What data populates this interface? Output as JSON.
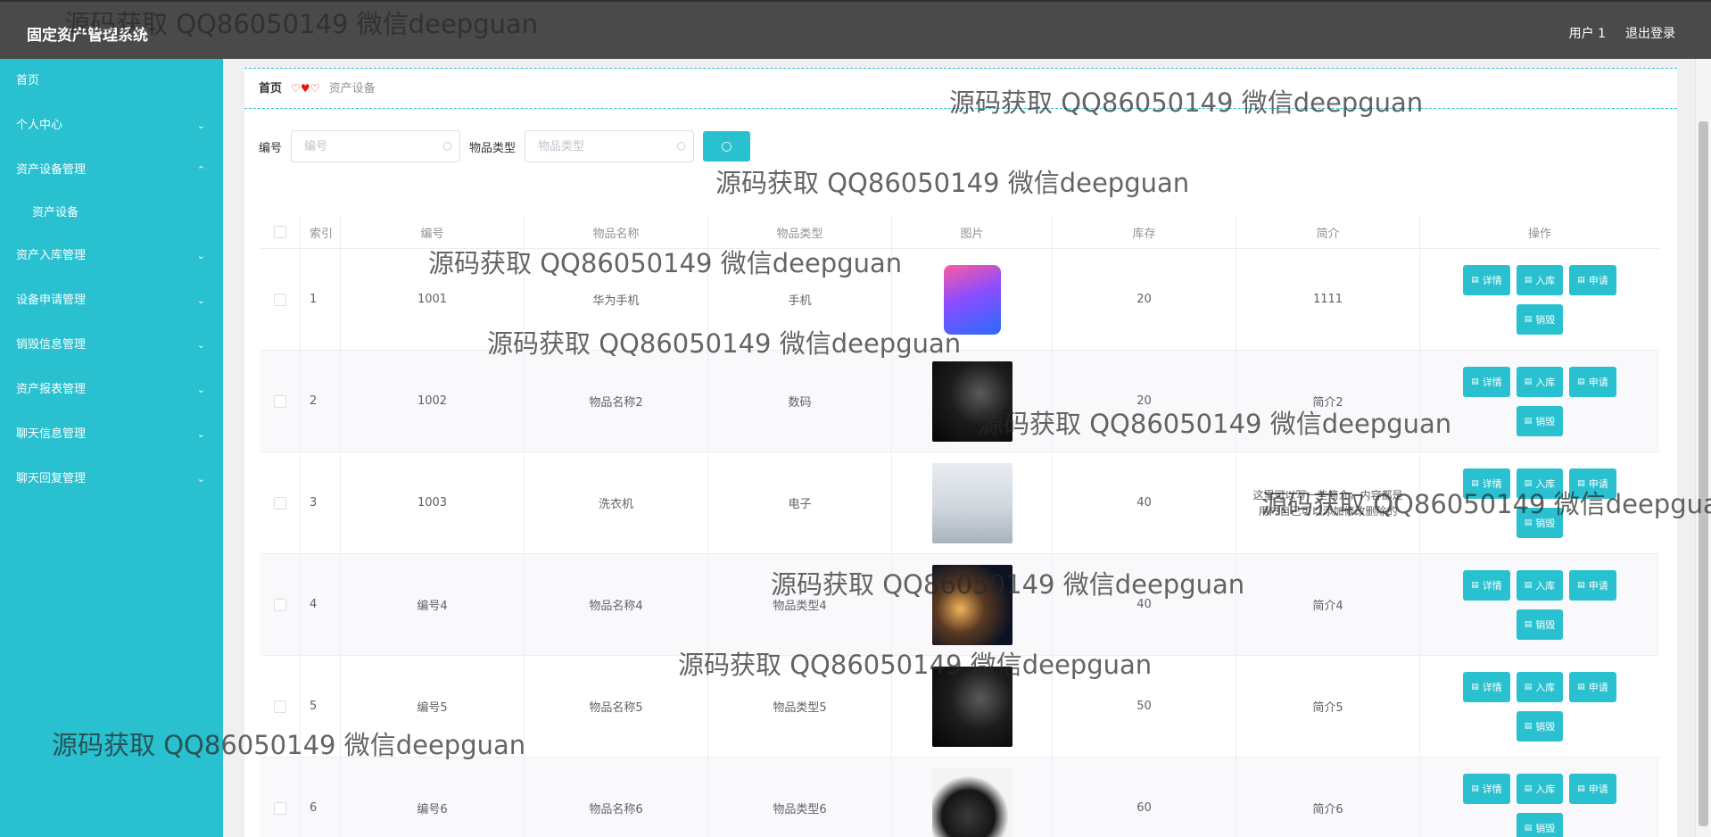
{
  "app": {
    "title": "固定资产管理系统"
  },
  "header": {
    "user": "用户 1",
    "logout": "退出登录"
  },
  "sidebar": {
    "items": [
      {
        "label": "首页",
        "chevron": ""
      },
      {
        "label": "个人中心",
        "chevron": "⌄"
      },
      {
        "label": "资产设备管理",
        "chevron": "⌃"
      },
      {
        "label": "资产设备",
        "chevron": ""
      },
      {
        "label": "资产入库管理",
        "chevron": "⌄"
      },
      {
        "label": "设备申请管理",
        "chevron": "⌄"
      },
      {
        "label": "销毁信息管理",
        "chevron": "⌄"
      },
      {
        "label": "资产报表管理",
        "chevron": "⌄"
      },
      {
        "label": "聊天信息管理",
        "chevron": "⌄"
      },
      {
        "label": "聊天回复管理",
        "chevron": "⌄"
      }
    ]
  },
  "breadcrumb": {
    "home": "首页",
    "separator": "♡♥♡",
    "current": "资产设备"
  },
  "search": {
    "code_label": "编号",
    "code_placeholder": "编号",
    "type_label": "物品类型",
    "type_placeholder": "物品类型",
    "button_icon": "search-icon"
  },
  "table": {
    "headers": {
      "index": "索引",
      "code": "编号",
      "name": "物品名称",
      "type": "物品类型",
      "image": "图片",
      "stock": "库存",
      "desc": "简介",
      "ops": "操作"
    },
    "rows": [
      {
        "index": "1",
        "code": "1001",
        "name": "华为手机",
        "type": "手机",
        "stock": "20",
        "desc": "1111",
        "image": "phone"
      },
      {
        "index": "2",
        "code": "1002",
        "name": "物品名称2",
        "type": "数码",
        "stock": "20",
        "desc": "简介2",
        "image": "dark"
      },
      {
        "index": "3",
        "code": "1003",
        "name": "洗衣机",
        "type": "电子",
        "stock": "40",
        "desc": "这里可以写一些简介，内容都是用户自己可以添加修改删除的",
        "image": "washer"
      },
      {
        "index": "4",
        "code": "编号4",
        "name": "物品名称4",
        "type": "物品类型4",
        "stock": "40",
        "desc": "简介4",
        "image": "projector"
      },
      {
        "index": "5",
        "code": "编号5",
        "name": "物品名称5",
        "type": "物品类型5",
        "stock": "50",
        "desc": "简介5",
        "image": "dark"
      },
      {
        "index": "6",
        "code": "编号6",
        "name": "物品名称6",
        "type": "物品类型6",
        "stock": "60",
        "desc": "简介6",
        "image": "camera"
      }
    ],
    "actions": {
      "detail": "详情",
      "stock_in": "入库",
      "apply": "申请",
      "destroy": "销毁"
    }
  },
  "watermark": {
    "text": "源码获取 QQ86050149 微信deepguan"
  },
  "colors": {
    "accent": "#29c0d0",
    "header_bg": "#4a4a4a",
    "sidebar_bg": "#29c0d0"
  }
}
